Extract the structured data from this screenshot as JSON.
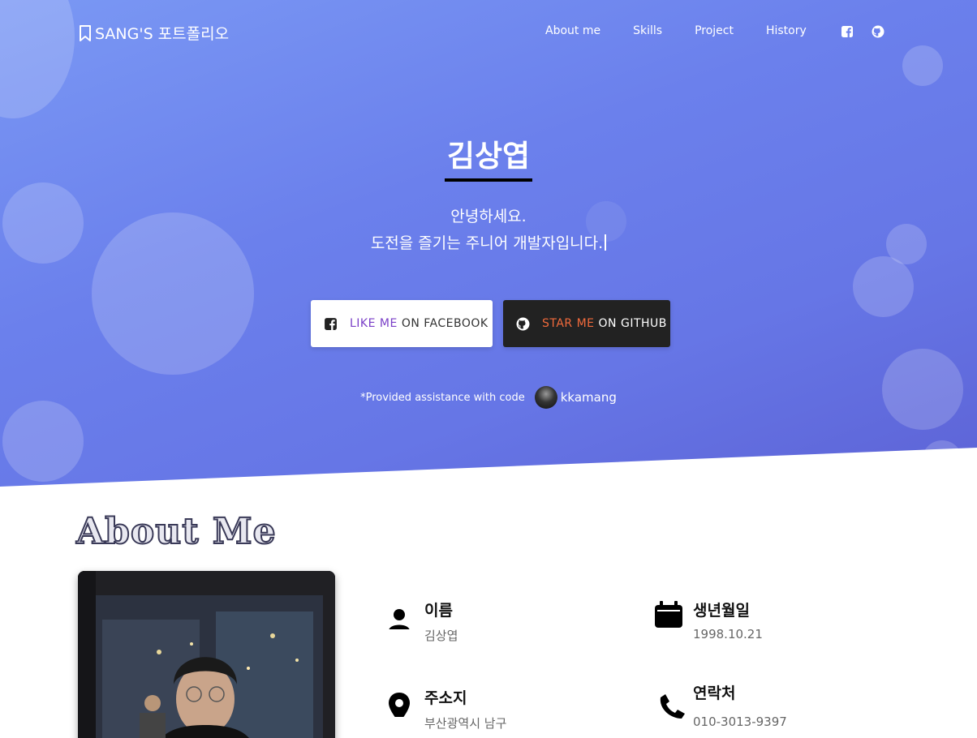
{
  "nav": {
    "brand": "SANG'S 포트폴리오",
    "links": [
      "About me",
      "Skills",
      "Project",
      "History"
    ]
  },
  "hero": {
    "name": "김상엽",
    "greeting_line1": "안녕하세요.",
    "greeting_line2": "도전을 즐기는 주니어 개발자입니다.",
    "facebook_button": {
      "accent": "LIKE ME",
      "rest": "ON FACEBOOK"
    },
    "github_button": {
      "accent": "STAR ME",
      "rest": "ON GITHUB"
    },
    "assist_text": "*Provided assistance with code",
    "assist_user": "kkamang"
  },
  "about": {
    "title": "About Me",
    "items": [
      {
        "label": "이름",
        "value": "김상엽",
        "icon": "user-icon"
      },
      {
        "label": "생년월일",
        "value": "1998.10.21",
        "icon": "calendar-icon"
      },
      {
        "label": "주소지",
        "value": "부산광역시 남구",
        "icon": "location-pin-icon"
      },
      {
        "label": "연락처",
        "value": "010-3013-9397",
        "icon": "phone-icon"
      }
    ]
  },
  "colors": {
    "hero_gradient_start": "#7a98f4",
    "hero_gradient_end": "#5d63d6",
    "facebook_accent": "#7a3fc7",
    "github_accent": "#f06a3c",
    "github_button_bg": "#222222"
  }
}
